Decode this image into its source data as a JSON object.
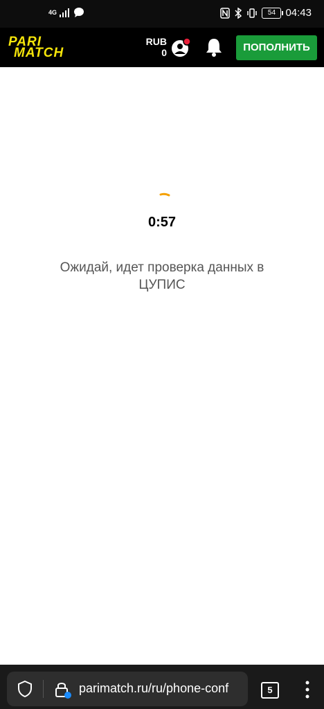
{
  "status_bar": {
    "network": "4G",
    "battery": "54",
    "time": "04:43"
  },
  "header": {
    "logo_line1": "PARI",
    "logo_line2": "MATCH",
    "currency": "RUB",
    "balance": "0",
    "deposit_label": "ПОПОЛНИТЬ",
    "brand_color": "#F5E50A",
    "accent_green": "#1A9C3A"
  },
  "main": {
    "timer": "0:57",
    "message": "Ожидай, идет проверка данных в ЦУПИС",
    "spinner_color": "#F5A000"
  },
  "browser": {
    "url": "parimatch.ru/ru/phone-conf",
    "tab_count": "5"
  }
}
